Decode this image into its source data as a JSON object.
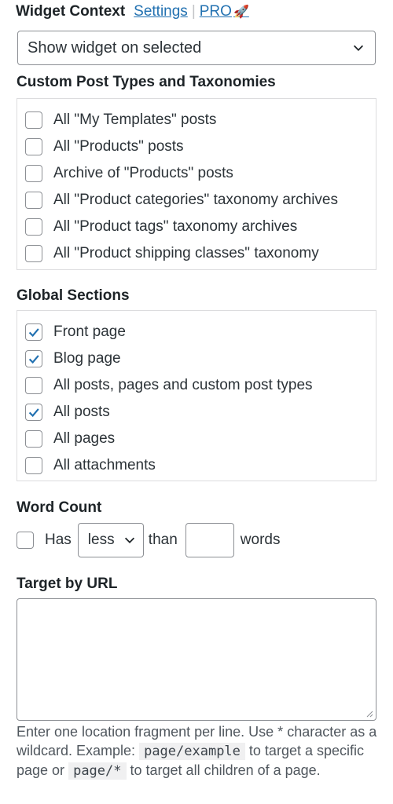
{
  "header": {
    "title": "Widget Context",
    "settings_link": "Settings",
    "separator": "|",
    "pro_link": "PRO",
    "rocket_icon": "🚀"
  },
  "visibility_select": {
    "value": "Show widget on selected",
    "icon": "chevron-down-icon"
  },
  "custom_post_types": {
    "title": "Custom Post Types and Taxonomies",
    "items": [
      {
        "label": "All \"My Templates\" posts",
        "checked": false
      },
      {
        "label": "All \"Products\" posts",
        "checked": false
      },
      {
        "label": "Archive of \"Products\" posts",
        "checked": false
      },
      {
        "label": "All \"Product categories\" taxonomy archives",
        "checked": false
      },
      {
        "label": "All \"Product tags\" taxonomy archives",
        "checked": false
      },
      {
        "label": "All \"Product shipping classes\" taxonomy",
        "checked": false
      }
    ]
  },
  "global_sections": {
    "title": "Global Sections",
    "items": [
      {
        "label": "Front page",
        "checked": true
      },
      {
        "label": "Blog page",
        "checked": true
      },
      {
        "label": "All posts, pages and custom post types",
        "checked": false
      },
      {
        "label": "All posts",
        "checked": true
      },
      {
        "label": "All pages",
        "checked": false
      },
      {
        "label": "All attachments",
        "checked": false
      }
    ]
  },
  "word_count": {
    "title": "Word Count",
    "has_label": "Has",
    "has_checked": false,
    "comparison_value": "less",
    "than_label": "than",
    "count_value": "",
    "words_label": "words"
  },
  "target_by_url": {
    "title": "Target by URL",
    "value": "",
    "help_text_1": "Enter one location fragment per line. Use * character as a wildcard. Example:",
    "example_1": "page/example",
    "help_text_2": "to target a specific page or",
    "example_2": "page/*",
    "help_text_3": "to target all children of a page."
  },
  "colors": {
    "link": "#2271b1",
    "check": "#2271b1",
    "border": "#8c8f94",
    "text": "#2c3338"
  }
}
